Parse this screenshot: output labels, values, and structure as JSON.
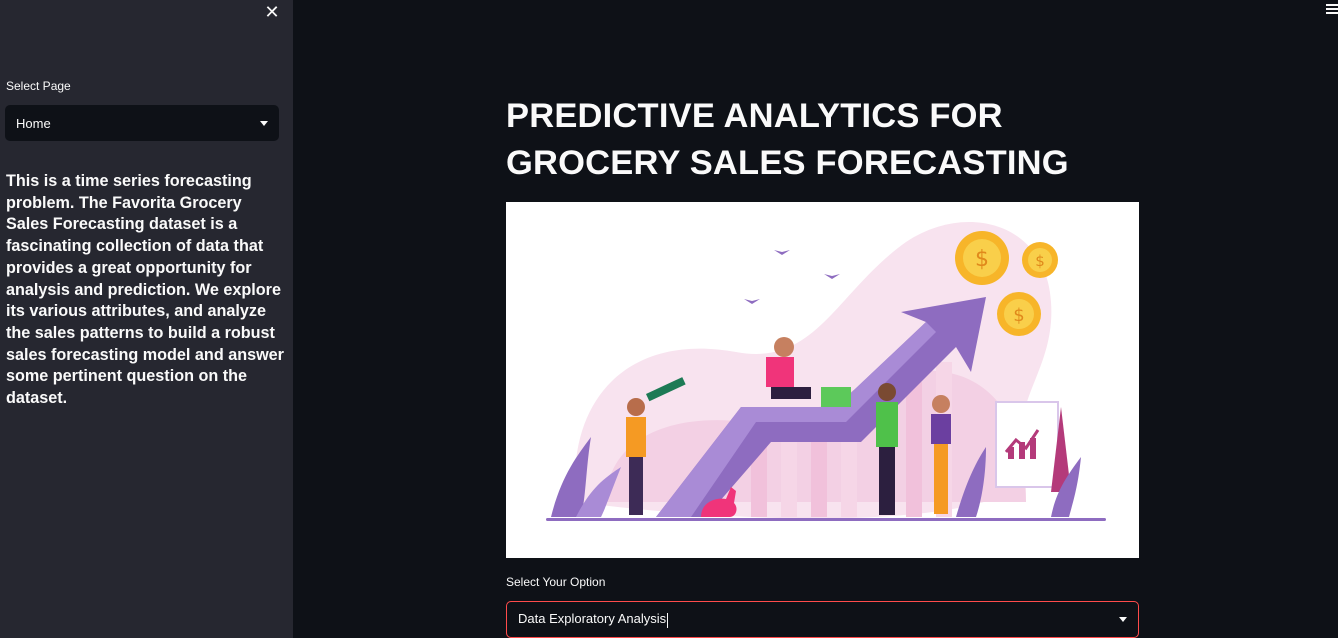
{
  "sidebar": {
    "close_icon": "close-icon",
    "select_label": "Select Page",
    "select_value": "Home",
    "description": "This is a time series forecasting problem. The Favorita Grocery Sales Forecasting dataset is a fascinating collection of data that provides a great opportunity for analysis and prediction. We explore its various attributes, and analyze the sales patterns to build a robust sales forecasting model and answer some pertinent question on the dataset."
  },
  "header": {
    "menu_icon": "hamburger-menu-icon"
  },
  "main": {
    "title": "PREDICTIVE ANALYTICS FOR GROCERY SALES FORECASTING",
    "option_label": "Select Your Option",
    "option_value": "Data Exploratory Analysis"
  },
  "colors": {
    "background": "#0e1117",
    "sidebar": "#262730",
    "focus_border": "#ff4b4b"
  }
}
